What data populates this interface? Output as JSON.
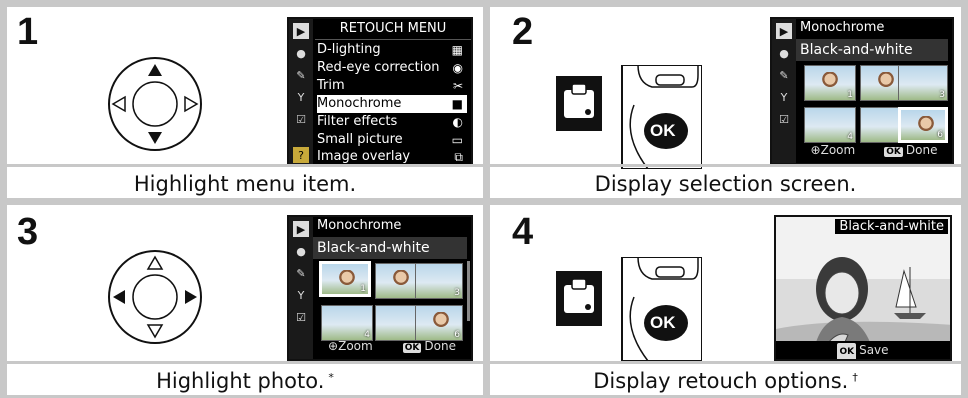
{
  "steps": [
    {
      "number": "1",
      "caption": "Highlight menu item.",
      "note": ""
    },
    {
      "number": "2",
      "caption": "Display selection screen.",
      "note": ""
    },
    {
      "number": "3",
      "caption": "Highlight photo.",
      "note": "*"
    },
    {
      "number": "4",
      "caption": "Display retouch options.",
      "note": "†"
    }
  ],
  "retouch_menu": {
    "title": "RETOUCH MENU",
    "items": [
      {
        "label": "D-lighting",
        "icon": "d-lighting-icon",
        "glyph": "▦"
      },
      {
        "label": "Red-eye correction",
        "icon": "eye-icon",
        "glyph": "◉"
      },
      {
        "label": "Trim",
        "icon": "scissors-icon",
        "glyph": "✂"
      },
      {
        "label": "Monochrome",
        "icon": "monochrome-icon",
        "glyph": "■",
        "selected": true
      },
      {
        "label": "Filter effects",
        "icon": "filter-icon",
        "glyph": "◐"
      },
      {
        "label": "Small picture",
        "icon": "small-picture-icon",
        "glyph": "▭"
      },
      {
        "label": "Image overlay",
        "icon": "overlay-icon",
        "glyph": "⧉"
      }
    ]
  },
  "selection_screen": {
    "title": "Monochrome",
    "subtitle": "Black-and-white",
    "thumbnails": [
      "1",
      "2",
      "3",
      "4",
      "5",
      "6"
    ],
    "zoom_label": "Zoom",
    "ok_label": "OK",
    "done_label": "Done"
  },
  "retouch_preview": {
    "title": "Black-and-white",
    "ok_label": "OK",
    "save_label": "Save"
  },
  "ok_button_label": "OK",
  "colors": {
    "panel": "#ffffff",
    "frame": "#c8c8c8",
    "lcd": "#000000"
  }
}
